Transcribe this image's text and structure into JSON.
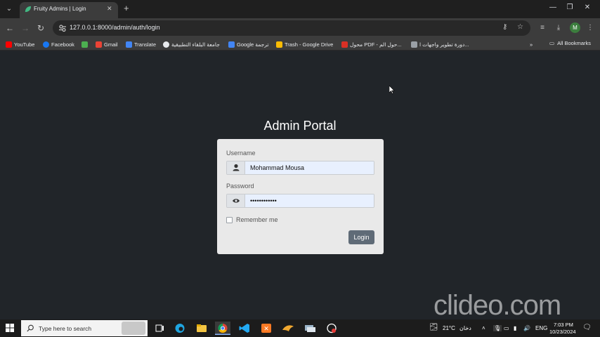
{
  "browser": {
    "tab_title": "Fruity Admins | Login",
    "url": "127.0.0.1:8000/admin/auth/login",
    "profile_initial": "M"
  },
  "bookmarks": [
    {
      "label": "YouTube",
      "color": "#ff0000"
    },
    {
      "label": "Facebook",
      "color": "#1877f2"
    },
    {
      "label": "",
      "color": "#4caf50"
    },
    {
      "label": "Gmail",
      "color": "#ea4335"
    },
    {
      "label": "Translate",
      "color": "#4285f4"
    },
    {
      "label": "جامعة البلقاء التطبيقية",
      "color": "#e8eaed"
    },
    {
      "label": "Google ترجمة",
      "color": "#4285f4"
    },
    {
      "label": "Trash - Google Drive",
      "color": "#fbbc04"
    },
    {
      "label": "محول PDF - حول الم...",
      "color": "#d93025"
    },
    {
      "label": "دورة تطوير واجهات ا...",
      "color": "#9aa0a6"
    }
  ],
  "bookmarks_more": "»",
  "all_bookmarks": "All Bookmarks",
  "login": {
    "title": "Admin Portal",
    "username_label": "Username",
    "username_value": "Mohammad Mousa",
    "password_label": "Password",
    "password_value": "••••••••••••",
    "remember_label": "Remember me",
    "button_label": "Login"
  },
  "watermark": "clideo.com",
  "taskbar": {
    "search_placeholder": "Type here to search",
    "weather": "21°C",
    "weather_desc": "دخان",
    "language": "ENG",
    "time": "7:03 PM",
    "date": "10/23/2024"
  },
  "colors": {
    "page_bg": "#212529",
    "card_bg": "#e9e9e9",
    "button_bg": "#5f6b77",
    "autofill_bg": "#e8f0fe"
  }
}
